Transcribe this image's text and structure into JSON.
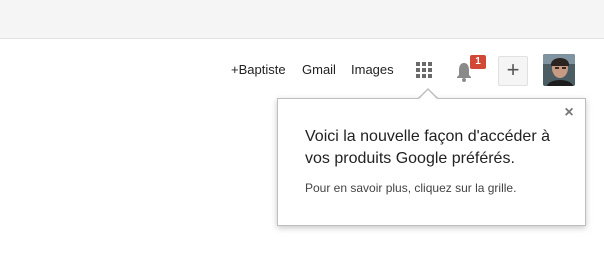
{
  "nav": {
    "user_link": "+Baptiste",
    "gmail": "Gmail",
    "images": "Images",
    "notifications_count": "1",
    "plus_label": "+"
  },
  "popup": {
    "title": "Voici la nouvelle façon d'accéder à vos produits Google préférés.",
    "subtitle": "Pour en savoir plus, cliquez sur la grille.",
    "close_label": "×"
  },
  "icons": {
    "apps": "apps-grid-icon",
    "bell": "bell-icon",
    "close": "close-icon",
    "avatar": "avatar"
  },
  "colors": {
    "badge": "#d14836",
    "top_band": "#f5f5f5"
  }
}
